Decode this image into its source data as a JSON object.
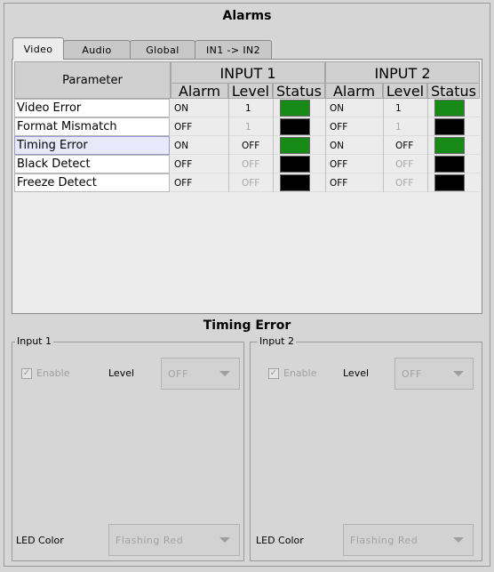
{
  "window": {
    "title": "Alarms"
  },
  "tabs": [
    {
      "label": "Video",
      "active": true
    },
    {
      "label": "Audio",
      "active": false
    },
    {
      "label": "Global",
      "active": false
    },
    {
      "label": "IN1 -> IN2",
      "active": false
    }
  ],
  "table": {
    "param_header": "Parameter",
    "inputs": [
      "INPUT 1",
      "INPUT 2"
    ],
    "subheaders": [
      "Alarm",
      "Level",
      "Status"
    ],
    "rows": [
      {
        "name": "Video Error",
        "selected": false,
        "in1": {
          "alarm": "ON",
          "level": "1",
          "level_dim": false,
          "status_color": "#178a17"
        },
        "in2": {
          "alarm": "ON",
          "level": "1",
          "level_dim": false,
          "status_color": "#178a17"
        }
      },
      {
        "name": "Format Mismatch",
        "selected": false,
        "in1": {
          "alarm": "OFF",
          "level": "1",
          "level_dim": true,
          "status_color": "#000000"
        },
        "in2": {
          "alarm": "OFF",
          "level": "1",
          "level_dim": true,
          "status_color": "#000000"
        }
      },
      {
        "name": "Timing Error",
        "selected": true,
        "in1": {
          "alarm": "ON",
          "level": "OFF",
          "level_dim": false,
          "status_color": "#178a17"
        },
        "in2": {
          "alarm": "ON",
          "level": "OFF",
          "level_dim": false,
          "status_color": "#178a17"
        }
      },
      {
        "name": "Black Detect",
        "selected": false,
        "in1": {
          "alarm": "OFF",
          "level": "OFF",
          "level_dim": true,
          "status_color": "#000000"
        },
        "in2": {
          "alarm": "OFF",
          "level": "OFF",
          "level_dim": true,
          "status_color": "#000000"
        }
      },
      {
        "name": "Freeze Detect",
        "selected": false,
        "in1": {
          "alarm": "OFF",
          "level": "OFF",
          "level_dim": true,
          "status_color": "#000000"
        },
        "in2": {
          "alarm": "OFF",
          "level": "OFF",
          "level_dim": true,
          "status_color": "#000000"
        }
      }
    ]
  },
  "detail": {
    "title": "Timing Error",
    "groups": [
      {
        "legend": "Input 1",
        "enable_label": "Enable",
        "enable_checked": true,
        "level_label": "Level",
        "level_value": "OFF",
        "led_label": "LED Color",
        "led_value": "Flashing Red"
      },
      {
        "legend": "Input 2",
        "enable_label": "Enable",
        "enable_checked": true,
        "level_label": "Level",
        "level_value": "OFF",
        "led_label": "LED Color",
        "led_value": "Flashing Red"
      }
    ]
  },
  "icons": {
    "checkbox": "check-icon",
    "dropdown": "chevron-down-icon"
  }
}
